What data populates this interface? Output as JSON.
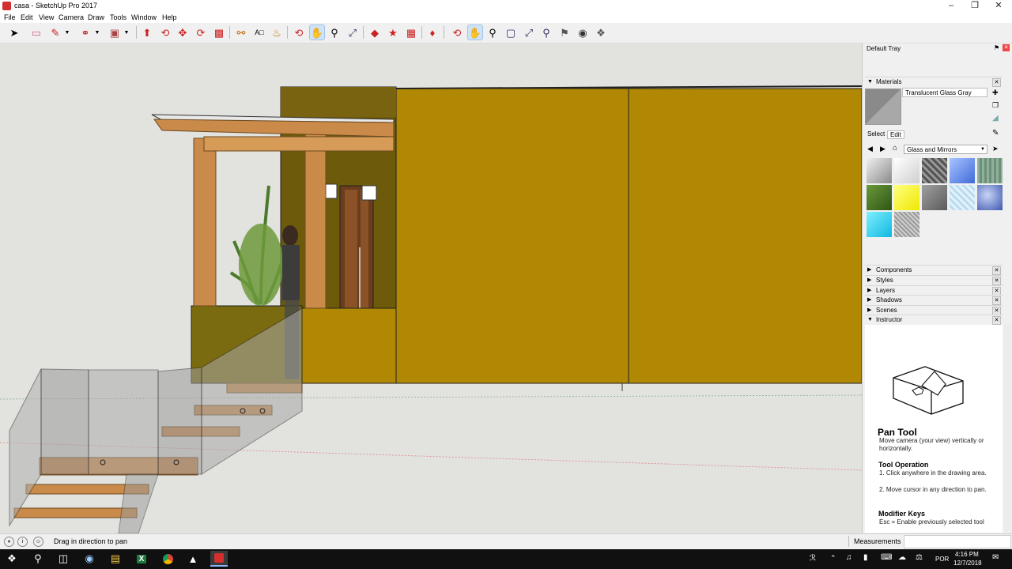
{
  "window": {
    "title": "casa - SketchUp Pro 2017",
    "icon": "sketchup-icon"
  },
  "menu": [
    "File",
    "Edit",
    "View",
    "Camera",
    "Draw",
    "Tools",
    "Window",
    "Help"
  ],
  "toolbar": {
    "icons": [
      "select-arrow-icon",
      "eraser-icon",
      "pencil-icon",
      "dropdown-arrow-icon",
      "arc-icon",
      "dropdown-arrow-icon",
      "rectangle-icon",
      "dropdown-arrow-icon",
      "push-pull-icon",
      "follow-me-icon",
      "move-icon",
      "rotate-icon",
      "scale-icon",
      "tape-measure-icon",
      "text-icon",
      "paint-bucket-icon",
      "orbit-icon",
      "pan-icon",
      "zoom-icon",
      "zoom-extents-icon",
      "components-icon",
      "warehouse-icon",
      "extension-icon",
      "ruby-icon",
      "orbit-icon",
      "pan-icon",
      "zoom-icon",
      "zoom-window-icon",
      "zoom-extents-icon",
      "position-camera-icon",
      "look-around-icon",
      "walk-icon"
    ],
    "active": "pan-icon"
  },
  "tray": {
    "title": "Default Tray",
    "materials": {
      "header": "Materials",
      "current_name": "Translucent Glass Gray",
      "tabs": [
        "Select",
        "Edit"
      ],
      "library": "Glass and Mirrors",
      "swatches": [
        "#b9b9b9",
        "#e6e6e6",
        "#6f6f6f",
        "#5a86e6",
        "#7fa08a",
        "#3f6d1f",
        "#ffff2e",
        "#7a7a7a",
        "#cfe6f2",
        "#5b78c8",
        "#22d4f2",
        "#bdbdbd"
      ]
    },
    "panels": [
      "Components",
      "Styles",
      "Layers",
      "Shadows",
      "Scenes",
      "Instructor"
    ],
    "instructor": {
      "tool_name": "Pan Tool",
      "description": "Move camera (your view) vertically or horizontally.",
      "operation_header": "Tool Operation",
      "steps": [
        "1. Click anywhere in the drawing area.",
        "2. Move cursor in any direction to pan."
      ],
      "modifier_header": "Modifier Keys",
      "modifier_text": "Esc = Enable previously selected tool"
    }
  },
  "status": {
    "hint": "Drag in direction to pan",
    "measurements_label": "Measurements",
    "measurements_value": ""
  },
  "taskbar": {
    "apps": [
      "windows-start-icon",
      "search-icon",
      "task-view-icon",
      "network-app-icon",
      "file-explorer-icon",
      "excel-icon",
      "chrome-icon",
      "photos-icon",
      "sketchup-taskbar-icon"
    ],
    "language": "POR",
    "time": "4:16 PM",
    "date": "12/7/2018"
  }
}
